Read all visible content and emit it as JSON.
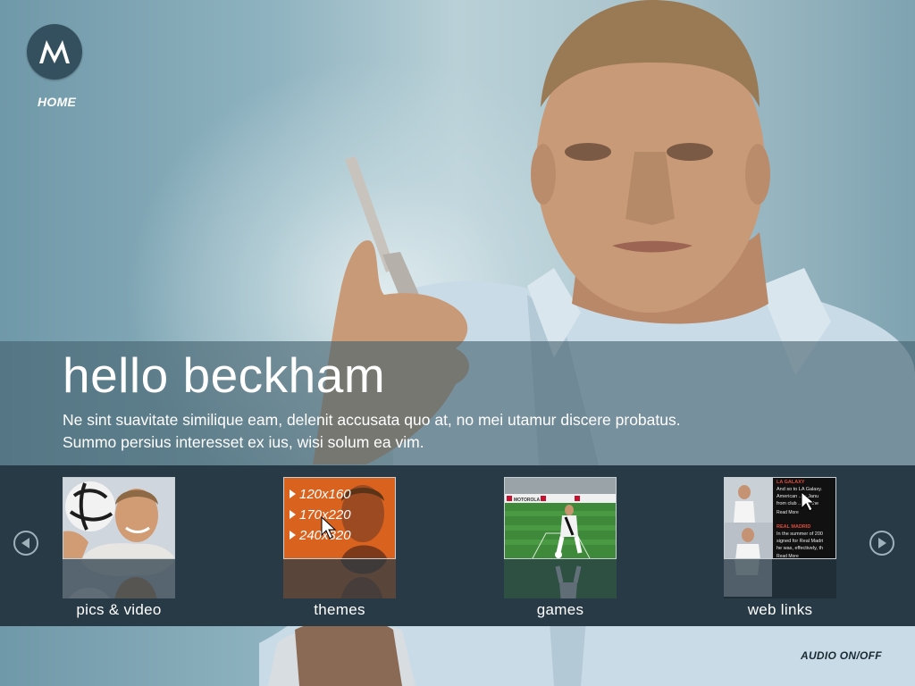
{
  "nav": {
    "home_label": "HOME"
  },
  "brand": {
    "logo_icon": "motorola-batwing-logo",
    "logo_color": "#34505f"
  },
  "hero": {
    "title": "hello beckham",
    "body_line1": "Ne sint suavitate similique eam, delenit accusata quo at, no mei utamur discere probatus.",
    "body_line2": "Summo persius interesset ex ius, wisi solum ea vim.",
    "image": "man-holding-flip-phone"
  },
  "carousel": {
    "prev_icon": "play-left-icon",
    "next_icon": "play-right-icon",
    "tiles": [
      {
        "label": "pics & video",
        "thumbnail": "man-with-soccer-ball-photo"
      },
      {
        "label": "themes",
        "thumbnail": "wallpaper-size-list",
        "sizes": [
          "120x160",
          "170x220",
          "240x320"
        ]
      },
      {
        "label": "games",
        "thumbnail": "soccer-game-screenshot",
        "banner_text": "MOTOROLA"
      },
      {
        "label": "web links",
        "thumbnail": "news-page-screenshot",
        "headline1": "LA GALAXY",
        "text1": [
          "And so to LA Galaxy.",
          "American ...in Janu",
          "from club ...and the",
          "Read More"
        ],
        "headline2": "REAL MADRID",
        "text2": [
          "In the summer of 200",
          "signed for Real Madri",
          "he was, effectively, th",
          "Read More"
        ]
      }
    ]
  },
  "footer": {
    "audio_label": "AUDIO ON/OFF"
  },
  "colors": {
    "strip": "#273a46",
    "hero_band": "#46627099",
    "accent_orange": "#d9621e",
    "pitch_green": "#3f8a3a"
  }
}
